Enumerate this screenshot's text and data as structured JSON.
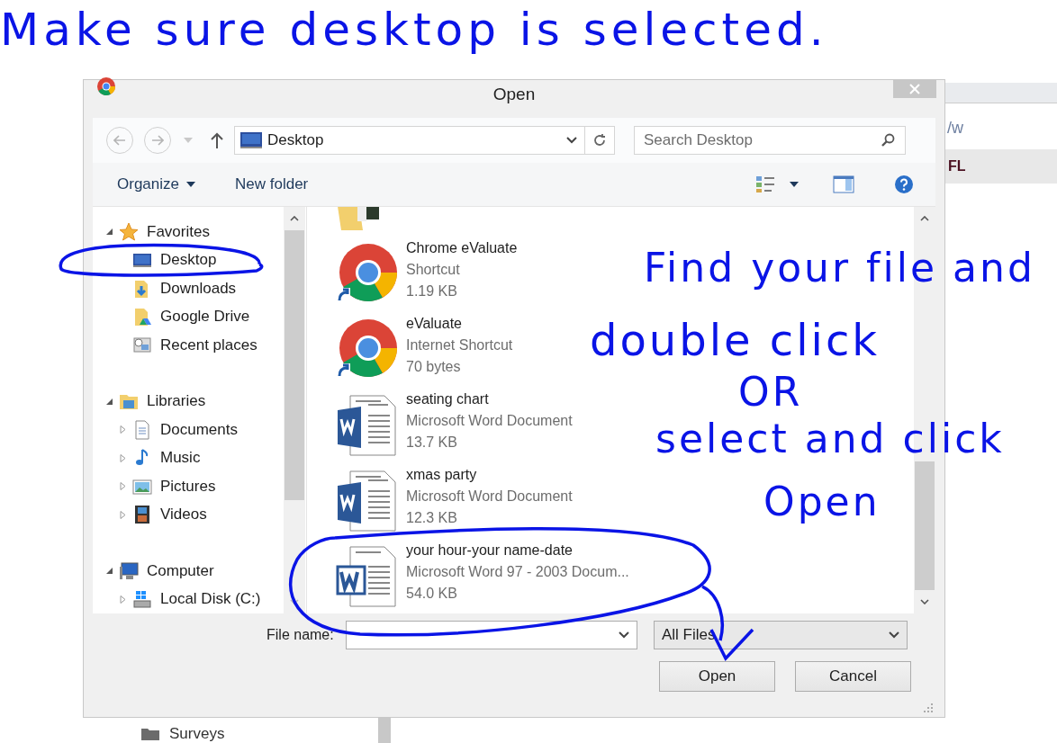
{
  "annotations": [
    {
      "text": "Make sure desktop is selected."
    },
    {
      "text": "Find your file and"
    },
    {
      "text": "double click"
    },
    {
      "text": "OR"
    },
    {
      "text": "select and click"
    },
    {
      "text": "Open"
    }
  ],
  "background": {
    "address_fragment": "/w",
    "tab_fragment": "FL",
    "folder": "Surveys"
  },
  "window": {
    "title": "Open"
  },
  "navigation": {
    "address": "Desktop",
    "search": {
      "placeholder": "Search Desktop"
    }
  },
  "toolbar": {
    "organize": "Organize",
    "new_folder": "New folder"
  },
  "tree": [
    {
      "label": "Favorites",
      "expanded": true,
      "children": [
        {
          "label": "Desktop"
        },
        {
          "label": "Downloads"
        },
        {
          "label": "Google Drive"
        },
        {
          "label": "Recent places"
        }
      ]
    },
    {
      "label": "Libraries",
      "expanded": true,
      "children": [
        {
          "label": "Documents",
          "expanded": false
        },
        {
          "label": "Music",
          "expanded": false
        },
        {
          "label": "Pictures",
          "expanded": false
        },
        {
          "label": "Videos",
          "expanded": false
        }
      ]
    },
    {
      "label": "Computer",
      "expanded": true,
      "children": [
        {
          "label": "Local Disk (C:)",
          "expanded": false
        }
      ]
    }
  ],
  "files": [
    {
      "kind": "chrome",
      "name": "Chrome eValuate",
      "type": "Shortcut",
      "size": "1.19 KB"
    },
    {
      "kind": "chrome",
      "name": "eValuate",
      "type": "Internet Shortcut",
      "size": "70 bytes"
    },
    {
      "kind": "word",
      "name": "seating chart",
      "type": "Microsoft Word Document",
      "size": "13.7 KB"
    },
    {
      "kind": "word",
      "name": "xmas party",
      "type": "Microsoft Word Document",
      "size": "12.3 KB"
    },
    {
      "kind": "word97",
      "name": "your hour-your name-date",
      "type": "Microsoft Word 97 - 2003 Docum...",
      "size": "54.0 KB"
    }
  ],
  "footer": {
    "file_name_label": "File name:",
    "filter": "All Files",
    "buttons": [
      "Open",
      "Cancel"
    ]
  }
}
